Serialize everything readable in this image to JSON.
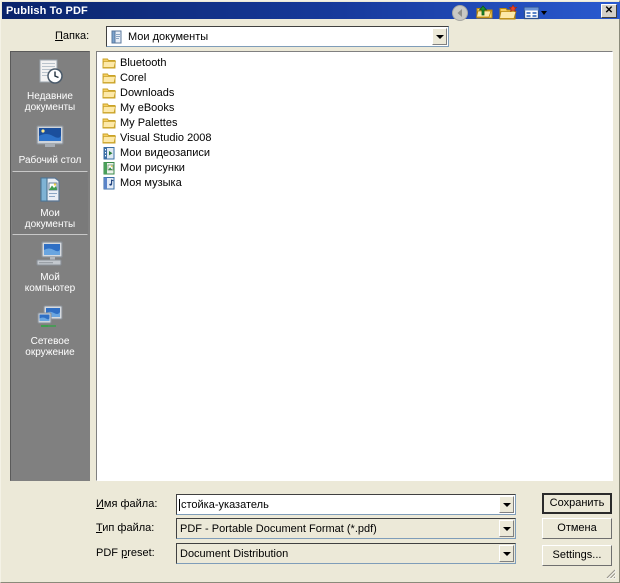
{
  "window": {
    "title": "Publish To PDF",
    "close_label": "✕"
  },
  "lookin": {
    "label_pre": "",
    "label_acc": "П",
    "label_post": "апка:",
    "value": "Мои документы",
    "icon": "my-documents-icon"
  },
  "toolbar": {
    "items": [
      {
        "name": "back-button",
        "icon": "back-arrow-icon",
        "enabled": false
      },
      {
        "name": "up-one-level-button",
        "icon": "up-folder-icon",
        "enabled": true
      },
      {
        "name": "create-new-folder-button",
        "icon": "new-folder-icon",
        "enabled": true
      },
      {
        "name": "views-button",
        "icon": "views-icon",
        "enabled": true
      }
    ]
  },
  "places": {
    "items": [
      {
        "label_line1": "Недавние",
        "label_line2": "документы",
        "icon": "recent-documents-icon",
        "selected": false
      },
      {
        "label_line1": "Рабочий стол",
        "label_line2": "",
        "icon": "desktop-icon",
        "selected": false
      },
      {
        "label_line1": "Мои",
        "label_line2": "документы",
        "icon": "my-documents-icon",
        "selected": true
      },
      {
        "label_line1": "Мой",
        "label_line2": "компьютер",
        "icon": "my-computer-icon",
        "selected": false
      },
      {
        "label_line1": "Сетевое",
        "label_line2": "окружение",
        "icon": "network-places-icon",
        "selected": false
      }
    ]
  },
  "filelist": {
    "items": [
      {
        "name": "Bluetooth",
        "icon": "folder-icon"
      },
      {
        "name": "Corel",
        "icon": "folder-icon"
      },
      {
        "name": "Downloads",
        "icon": "folder-icon"
      },
      {
        "name": "My eBooks",
        "icon": "folder-icon"
      },
      {
        "name": "My Palettes",
        "icon": "folder-icon"
      },
      {
        "name": "Visual Studio 2008",
        "icon": "folder-icon"
      },
      {
        "name": "Мои видеозаписи",
        "icon": "my-videos-icon"
      },
      {
        "name": "Мои рисунки",
        "icon": "my-pictures-icon"
      },
      {
        "name": "Моя музыка",
        "icon": "my-music-icon"
      }
    ]
  },
  "form": {
    "filename": {
      "label_acc": "И",
      "label_post": "мя файла:",
      "value": "стойка-указатель"
    },
    "filetype": {
      "label_acc": "Т",
      "label_post": "ип файла:",
      "value": "PDF - Portable Document Format (*.pdf)"
    },
    "preset": {
      "label_pre": "PDF ",
      "label_acc": "p",
      "label_post": "reset:",
      "value": "Document Distribution"
    }
  },
  "buttons": {
    "save": "Сохранить",
    "save_acc": "х",
    "cancel": "Отмена",
    "settings": "Settings...",
    "settings_acc": "e"
  },
  "colors": {
    "titlebar_start": "#0a246a",
    "titlebar_end": "#2a5ad0",
    "dialog_face": "#ECE9D8",
    "places_bar": "#808080",
    "list_bg": "#ffffff",
    "folder_yellow": "#FCDE8A"
  }
}
